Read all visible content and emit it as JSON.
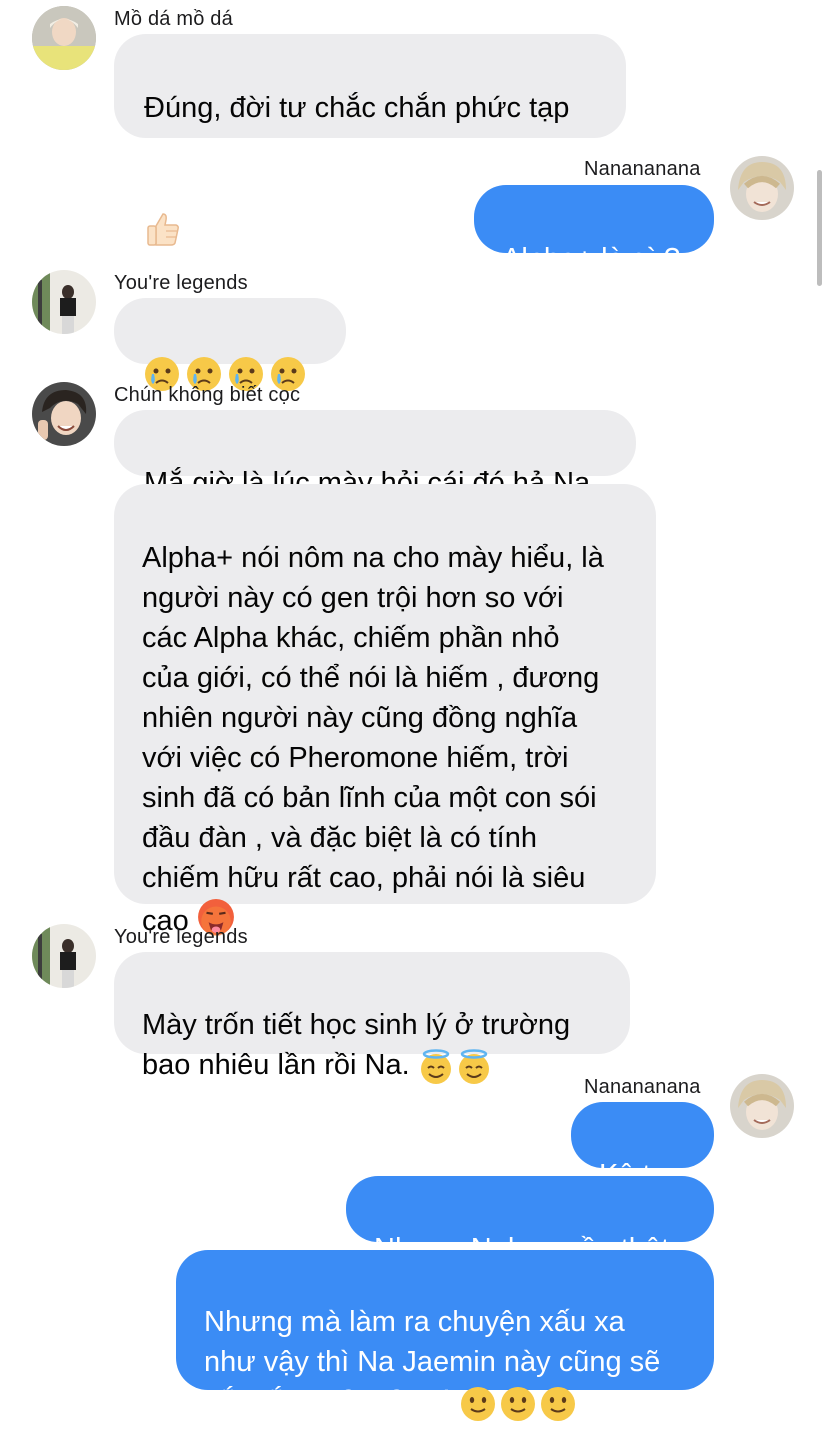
{
  "messages": [
    {
      "sender": "Mồ dá mồ dá",
      "text": "Đúng, đời tư chắc chắn phức tạp",
      "emoji": "thumbs-up"
    },
    {
      "sender": "Nanananana",
      "text": "Alpha+ là gì ?"
    },
    {
      "sender": "You're legends",
      "emoji": "crying-face x4"
    },
    {
      "sender": "Chún không biết cọc",
      "text": "Mắ giờ là lúc mày hỏi cái đó hả Na"
    },
    {
      "sender": "Chún không biết cọc",
      "text": "Alpha+ nói nôm na cho mày hiểu, là người này có gen trội hơn so với các Alpha khác, chiếm phần nhỏ của giới, có thể nói là hiếm , đương nhiên người này cũng đồng nghĩa với việc có  Pheromone hiếm, trời sinh đã có bản lĩnh của một con sói đầu đàn , và đặc biệt là có tính chiếm hữu rất cao, phải nói là siêu cao",
      "emoji": "hot-face"
    },
    {
      "sender": "You're legends",
      "text": "Mày trốn tiết học sinh lý ở trường bao nhiêu lần rồi Na.",
      "emoji": "halo-face x2"
    },
    {
      "sender": "Nanananana",
      "text": "Kệ tao"
    },
    {
      "sender": "Nanananana",
      "text": "Nhưng Nghe ngầu thật"
    },
    {
      "sender": "Nanananana",
      "text": "Nhưng mà làm ra chuyện xấu xa như vậy thì Na Jaemin này cũng sẽ bắt hắn phải trả giá",
      "emoji": "slight-smile x3"
    }
  ],
  "names": {
    "mo_da": "Mồ dá mồ dá",
    "nana": "Nanananana",
    "legends": "You're legends",
    "chun": "Chún không biết cọc"
  },
  "texts": {
    "m1": "Đúng, đời tư chắc chắn phức tạp",
    "m2": "Alpha+ là gì ?",
    "m4": "Mắ giờ là lúc mày hỏi cái đó hả Na",
    "m5": "Alpha+ nói nôm na cho mày hiểu, là\nngười này có gen trội hơn so với\ncác Alpha khác, chiếm phần nhỏ\ncủa giới, có thể nói là hiếm , đương\nnhiên người này cũng đồng nghĩa\nvới việc có  Pheromone hiếm, trời\nsinh đã có bản lĩnh của một con sói\nđầu đàn , và đặc biệt là có tính\nchiếm hữu rất cao, phải nói là siêu\ncao ",
    "m6": "Mày trốn tiết học sinh lý ở trường\nbao nhiêu lần rồi Na. ",
    "m7": "Kệ tao",
    "m8": "Nhưng Nghe ngầu thật",
    "m9": "Nhưng mà làm ra chuyện xấu xa\nnhư vậy thì Na Jaemin này cũng sẽ\nbắt hắn phải trả giá "
  },
  "colors": {
    "incoming_bubble": "#ececee",
    "outgoing_bubble": "#3b8cf5",
    "emoji_yellow": "#f7c948"
  }
}
